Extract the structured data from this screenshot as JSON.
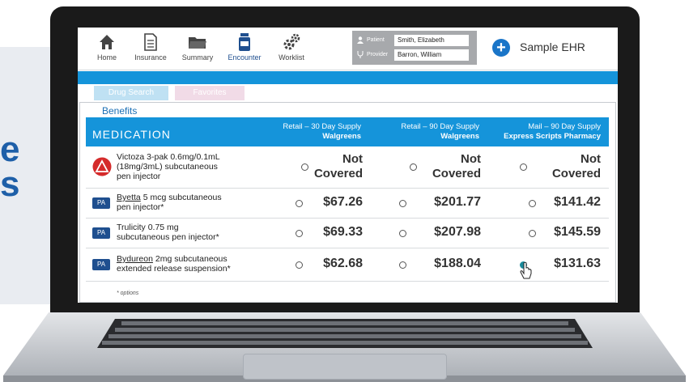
{
  "slide": {
    "side_letters": [
      "e",
      "s"
    ]
  },
  "toolbar": {
    "home": "Home",
    "insurance": "Insurance",
    "summary": "Summary",
    "encounter": "Encounter",
    "worklist": "Worklist"
  },
  "context": {
    "patient_label": "Patient",
    "patient_value": "Smith, Elizabeth",
    "provider_label": "Provider",
    "provider_value": "Barron, William"
  },
  "brand": {
    "name": "Sample EHR"
  },
  "tabs": {
    "drug_search": "Drug Search",
    "favorites": "Favorites"
  },
  "section": {
    "title": "Benefits"
  },
  "table": {
    "medication_header": "MEDICATION",
    "columns": [
      {
        "line1": "Retail – 30 Day Supply",
        "line2": "Walgreens"
      },
      {
        "line1": "Retail – 90 Day Supply",
        "line2": "Walgreens"
      },
      {
        "line1": "Mail – 90 Day Supply",
        "line2": "Express Scripts Pharmacy"
      }
    ],
    "rows": [
      {
        "badge": "warning-icon",
        "name_lines": [
          "Victoza 3-pak 0.6mg/0.1mL",
          "(18mg/3mL) subcutaneous",
          "pen injector"
        ],
        "prices": [
          [
            "Not",
            "Covered"
          ],
          [
            "Not",
            "Covered"
          ],
          [
            "Not",
            "Covered"
          ]
        ]
      },
      {
        "badge": "PA",
        "name_main": "Byetta",
        "name_rest": " 5 mcg subcutaneous",
        "name_line2": "pen injector*",
        "prices": [
          "$67.26",
          "$201.77",
          "$141.42"
        ]
      },
      {
        "badge": "PA",
        "name_line1": "Trulicity  0.75 mg",
        "name_line2": "subcutaneous pen injector*",
        "prices": [
          "$69.33",
          "$207.98",
          "$145.59"
        ]
      },
      {
        "badge": "PA",
        "name_main": "Bydureon",
        "name_rest": " 2mg subcutaneous",
        "name_line2": "extended release suspension*",
        "prices": [
          "$62.68",
          "$188.04",
          "$131.63"
        ],
        "selected_column": 2
      }
    ],
    "footnote": "* options"
  },
  "colors": {
    "accent": "#1594da",
    "brand_blue": "#1a75c8",
    "pa_badge": "#1f4f8f",
    "warning": "#d52b2b",
    "selected_radio": "#1a8a9a"
  },
  "icons": [
    "home-icon",
    "document-icon",
    "folder-icon",
    "medication-bottle-icon",
    "gears-icon",
    "user-icon",
    "stethoscope-icon",
    "plus-circle-icon",
    "warning-icon",
    "cursor-icon"
  ]
}
